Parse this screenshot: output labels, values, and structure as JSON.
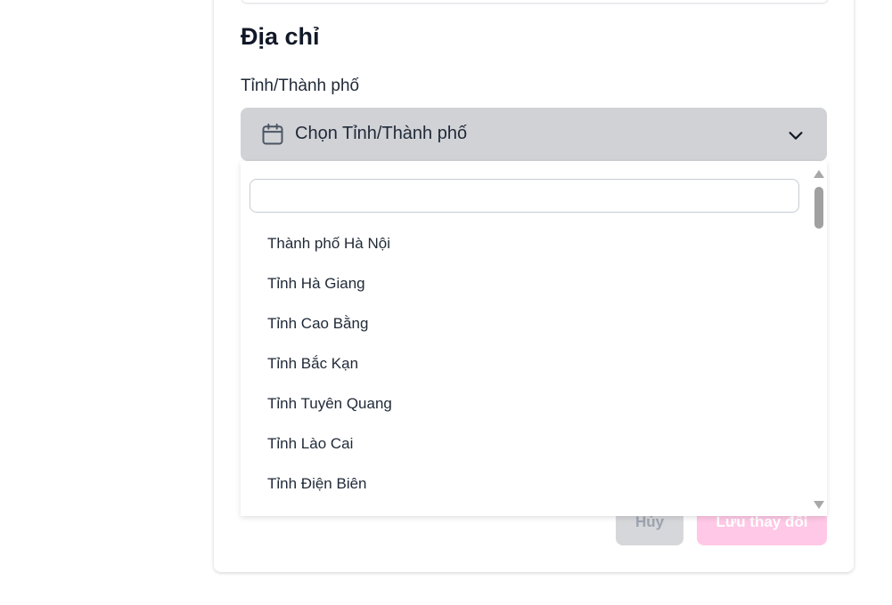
{
  "section": {
    "title": "Địa chỉ"
  },
  "province": {
    "label": "Tỉnh/Thành phố",
    "placeholder": "Chọn Tỉnh/Thành phố",
    "search_value": "",
    "options": [
      "Thành phố Hà Nội",
      "Tỉnh Hà Giang",
      "Tỉnh Cao Bằng",
      "Tỉnh Bắc Kạn",
      "Tỉnh Tuyên Quang",
      "Tỉnh Lào Cai",
      "Tỉnh Điện Biên"
    ]
  },
  "actions": {
    "cancel_label": "Hủy",
    "save_label": "Lưu thay đổi"
  },
  "icons": {
    "select_leading": "calendar-icon",
    "select_trailing": "chevron-down-icon"
  },
  "colors": {
    "select_bg": "#d1d2d6",
    "save_button_bg": "#ffc8e6",
    "cancel_button_bg": "#d6d7da"
  }
}
